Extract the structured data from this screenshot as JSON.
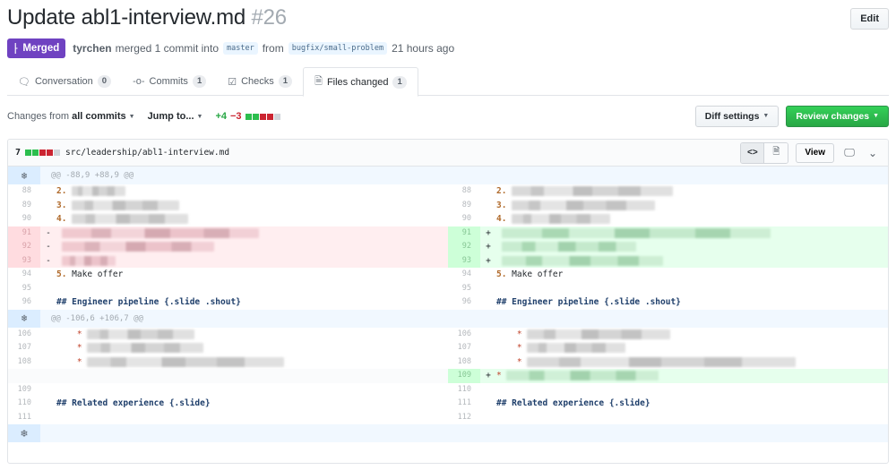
{
  "pr": {
    "title": "Update abl1-interview.md",
    "number": "#26",
    "edit_label": "Edit",
    "state": "Merged",
    "author": "tyrchen",
    "merge_text": "merged 1 commit into",
    "base_branch": "master",
    "from_text": "from",
    "head_branch": "bugfix/small-problem",
    "time": "21 hours ago"
  },
  "tabs": [
    {
      "label": "Conversation",
      "count": "0",
      "icon": "comment-icon"
    },
    {
      "label": "Commits",
      "count": "1",
      "icon": "commit-icon"
    },
    {
      "label": "Checks",
      "count": "1",
      "icon": "checklist-icon"
    },
    {
      "label": "Files changed",
      "count": "1",
      "icon": "file-diff-icon",
      "active": true
    }
  ],
  "toolbar": {
    "changes_from_prefix": "Changes from",
    "changes_from_value": "all commits",
    "jump_to": "Jump to...",
    "additions": "+4",
    "deletions": "−3",
    "diffstat": [
      "add",
      "add",
      "del",
      "del",
      "neutral"
    ],
    "diff_settings": "Diff settings",
    "review_changes": "Review changes"
  },
  "file": {
    "change_count": "7",
    "diffstat": [
      "add",
      "add",
      "del",
      "del",
      "neutral"
    ],
    "path": "src/leadership/abl1-interview.md",
    "view_label": "View",
    "hunks": [
      {
        "header": "@@ -88,9 +88,9 @@",
        "rows": [
          {
            "left": {
              "ln": "88",
              "type": "ctx",
              "prefix": "2.",
              "text": "",
              "blurred": true
            },
            "right": {
              "ln": "88",
              "type": "ctx",
              "prefix": "2.",
              "text": "",
              "blurred": true
            }
          },
          {
            "left": {
              "ln": "89",
              "type": "ctx",
              "prefix": "3.",
              "text": "",
              "blurred": true
            },
            "right": {
              "ln": "89",
              "type": "ctx",
              "prefix": "3.",
              "text": "",
              "blurred": true
            }
          },
          {
            "left": {
              "ln": "90",
              "type": "ctx",
              "prefix": "4.",
              "text": "",
              "blurred": true
            },
            "right": {
              "ln": "90",
              "type": "ctx",
              "prefix": "4.",
              "text": "",
              "blurred": true
            }
          },
          {
            "left": {
              "ln": "91",
              "type": "del",
              "marker": "-",
              "text": "",
              "blurred": true
            },
            "right": {
              "ln": "91",
              "type": "add",
              "marker": "+",
              "text": "",
              "blurred": true
            }
          },
          {
            "left": {
              "ln": "92",
              "type": "del",
              "marker": "-",
              "text": "",
              "blurred": true
            },
            "right": {
              "ln": "92",
              "type": "add",
              "marker": "+",
              "text": "",
              "blurred": true
            }
          },
          {
            "left": {
              "ln": "93",
              "type": "del",
              "marker": "-",
              "text": "",
              "blurred": true
            },
            "right": {
              "ln": "93",
              "type": "add",
              "marker": "+",
              "text": "",
              "blurred": true
            }
          },
          {
            "left": {
              "ln": "94",
              "type": "ctx",
              "prefix": "5.",
              "text": " Make offer"
            },
            "right": {
              "ln": "94",
              "type": "ctx",
              "prefix": "5.",
              "text": " Make offer"
            }
          },
          {
            "left": {
              "ln": "95",
              "type": "ctx",
              "text": ""
            },
            "right": {
              "ln": "95",
              "type": "ctx",
              "text": ""
            }
          },
          {
            "left": {
              "ln": "96",
              "type": "ctx",
              "heading": "## Engineer pipeline {.slide .shout}"
            },
            "right": {
              "ln": "96",
              "type": "ctx",
              "heading": "## Engineer pipeline {.slide .shout}"
            }
          }
        ]
      },
      {
        "header": "@@ -106,6 +106,7 @@",
        "rows": [
          {
            "left": {
              "ln": "106",
              "type": "ctx",
              "bullet": "*",
              "text": "",
              "blurred": true
            },
            "right": {
              "ln": "106",
              "type": "ctx",
              "bullet": "*",
              "text": "",
              "blurred": true
            }
          },
          {
            "left": {
              "ln": "107",
              "type": "ctx",
              "bullet": "*",
              "text": "",
              "blurred": true
            },
            "right": {
              "ln": "107",
              "type": "ctx",
              "bullet": "*",
              "text": "",
              "blurred": true
            }
          },
          {
            "left": {
              "ln": "108",
              "type": "ctx",
              "bullet": "*",
              "text": "",
              "blurred": true
            },
            "right": {
              "ln": "108",
              "type": "ctx",
              "bullet": "*",
              "text": "",
              "blurred": true
            }
          },
          {
            "left": {
              "ln": "",
              "type": "empty"
            },
            "right": {
              "ln": "109",
              "type": "add",
              "marker": "+",
              "bullet": "*",
              "text": "",
              "blurred": true
            }
          },
          {
            "left": {
              "ln": "109",
              "type": "ctx",
              "text": ""
            },
            "right": {
              "ln": "110",
              "type": "ctx",
              "text": ""
            }
          },
          {
            "left": {
              "ln": "110",
              "type": "ctx",
              "heading": "## Related experience {.slide}"
            },
            "right": {
              "ln": "111",
              "type": "ctx",
              "heading": "## Related experience {.slide}"
            }
          },
          {
            "left": {
              "ln": "111",
              "type": "ctx",
              "text": ""
            },
            "right": {
              "ln": "112",
              "type": "ctx",
              "text": ""
            }
          }
        ]
      }
    ]
  },
  "colors": {
    "merged": "#6f42c1",
    "primary_button": "#28a745",
    "addition_bg": "#e6ffed",
    "deletion_bg": "#ffeef0",
    "hunk_bg": "#f1f8ff"
  }
}
